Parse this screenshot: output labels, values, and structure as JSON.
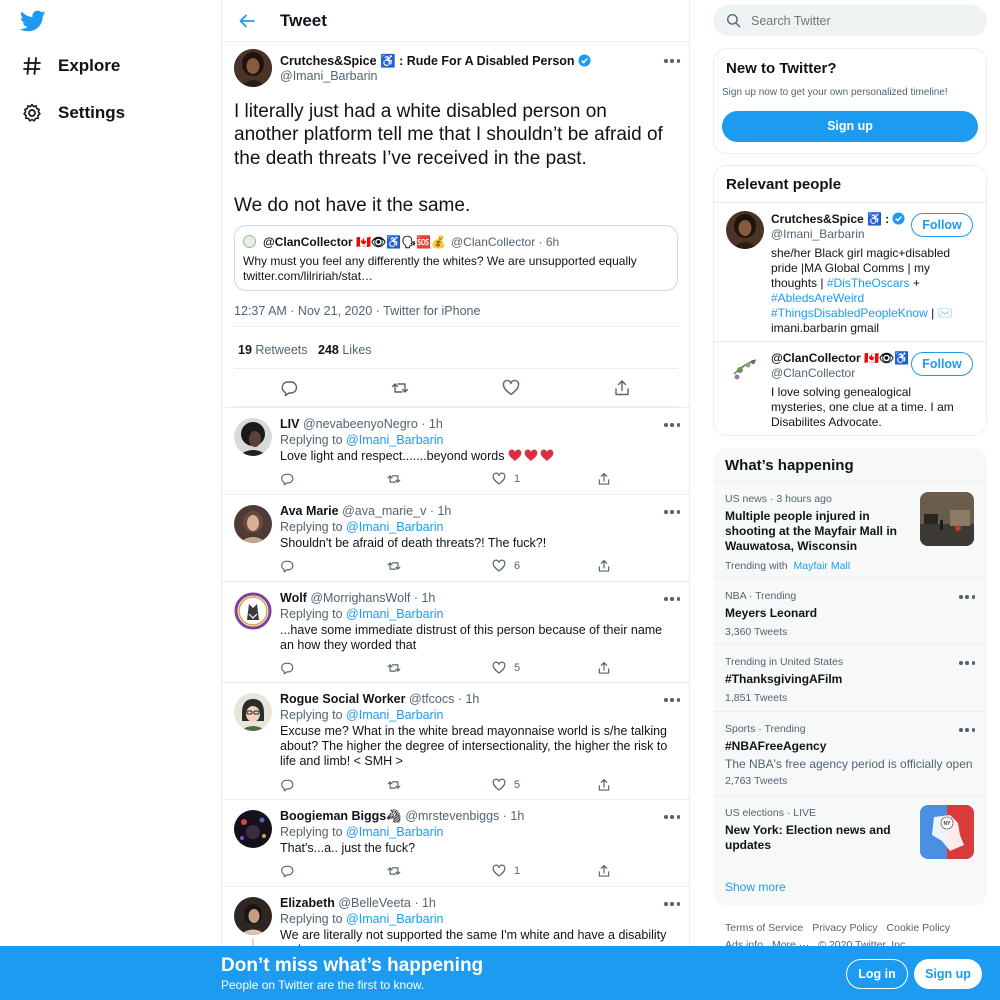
{
  "nav": {
    "items": [
      {
        "label": "Explore",
        "icon": "hashtag-icon"
      },
      {
        "label": "Settings",
        "icon": "gear-icon"
      }
    ]
  },
  "header": {
    "title": "Tweet"
  },
  "main_tweet": {
    "author_name": "Crutches&Spice ♿ : Rude For A Disabled Person",
    "handle": "@Imani_Barbarin",
    "text": "I literally just had a white disabled person on another platform tell me that I shouldn’t be afraid of the death threats I’ve received in the past.\n\nWe do not have it the same.",
    "quote": {
      "name": "@ClanCollector 🇨🇦👁♿🗣🆘💰",
      "meta": "@ClanCollector · 6h",
      "text": "Why must you feel any differently the whites? We are unsupported equally twitter.com/lilririah/stat…"
    },
    "time": "12:37 AM · Nov 21, 2020 · Twitter for iPhone",
    "retweets": "19",
    "retweets_label": "Retweets",
    "likes": "248",
    "likes_label": "Likes"
  },
  "replies": [
    {
      "name": "LIV",
      "handle": "@nevabeenyoNegro",
      "time": "· 1h",
      "replying_prefix": "Replying to",
      "replying_to": "@Imani_Barbarin",
      "text": "Love light and respect.......beyond words",
      "likes": "1"
    },
    {
      "name": "Ava Marie",
      "handle": "@ava_marie_v",
      "time": "· 1h",
      "replying_prefix": "Replying to",
      "replying_to": "@Imani_Barbarin",
      "text": "Shouldn't be afraid of death threats?! The fuck?!",
      "likes": "6"
    },
    {
      "name": "Wolf",
      "handle": "@MorrighansWolf",
      "time": "· 1h",
      "replying_prefix": "Replying to",
      "replying_to": "@Imani_Barbarin",
      "text": "...have some immediate distrust of this person because of their name an how they worded that",
      "likes": "5"
    },
    {
      "name": "Rogue Social Worker",
      "handle": "@tfcocs",
      "time": "· 1h",
      "replying_prefix": "Replying to",
      "replying_to": "@Imani_Barbarin",
      "text": "Excuse me? What in the white bread mayonnaise world is s/he talking about? The higher the degree of intersectionality, the higher the risk to life and limb! < SMH >",
      "likes": "5"
    },
    {
      "name": "Boogieman Biggs🦓",
      "handle": "@mrstevenbiggs",
      "time": "· 1h",
      "replying_prefix": "Replying to",
      "replying_to": "@Imani_Barbarin",
      "text": "That's...a.. just the fuck?",
      "likes": "1"
    },
    {
      "name": "Elizabeth",
      "handle": "@BelleVeeta",
      "time": "· 1h",
      "replying_prefix": "Replying to",
      "replying_to": "@Imani_Barbarin",
      "text": "We are literally not supported the same I'm white and have a disability and",
      "likes": ""
    }
  ],
  "search": {
    "placeholder": "Search Twitter"
  },
  "new_to_twitter": {
    "title": "New to Twitter?",
    "subtitle": "Sign up now to get your own personalized timeline!",
    "button": "Sign up"
  },
  "relevant": {
    "title": "Relevant people",
    "people": [
      {
        "name": "Crutches&Spice ♿ :",
        "handle": "@Imani_Barbarin",
        "follow": "Follow",
        "bio_1": "she/her Black girl magic+disabled pride |MA Global Comms | my thoughts | ",
        "tag_1": "#DisTheOscars",
        "bio_2": " + ",
        "tag_2": "#AbledsAreWeird",
        "tag_3": "#ThingsDisabledPeopleKnow",
        "bio_3": " | ✉️ imani.barbarin gmail"
      },
      {
        "name": "@ClanCollector 🇨🇦👁♿",
        "handle": "@ClanCollector",
        "follow": "Follow",
        "bio_1": "I love solving genealogical mysteries, one clue at a time. I am Disabilites Advocate."
      }
    ]
  },
  "happening": {
    "title": "What’s happening",
    "trends": [
      {
        "meta": "US news · 3 hours ago",
        "title": "Multiple people injured in shooting at the Mayfair Mall in Wauwatosa, Wisconsin",
        "count_prefix": "Trending with",
        "count_link": "Mayfair Mall"
      },
      {
        "meta": "NBA · Trending",
        "title": "Meyers Leonard",
        "count": "3,360 Tweets"
      },
      {
        "meta": "Trending in United States",
        "title": "#ThanksgivingAFilm",
        "count": "1,851 Tweets"
      },
      {
        "meta": "Sports · Trending",
        "title": "#NBAFreeAgency",
        "desc": "The NBA's free agency period is officially open",
        "count": "2,763 Tweets"
      },
      {
        "meta": "US elections · LIVE",
        "title": "New York: Election news and updates"
      }
    ],
    "show_more": "Show more"
  },
  "footer": {
    "links": [
      "Terms of Service",
      "Privacy Policy",
      "Cookie Policy",
      "Ads info",
      "More ···",
      "© 2020 Twitter, Inc."
    ]
  },
  "bottom_bar": {
    "headline": "Don’t miss what’s happening",
    "sub": "People on Twitter are the first to know.",
    "login": "Log in",
    "signup": "Sign up"
  },
  "colors": {
    "accent": "#1d9bf0",
    "text": "#0f1419",
    "muted": "#536471",
    "border": "#ebeef0"
  }
}
